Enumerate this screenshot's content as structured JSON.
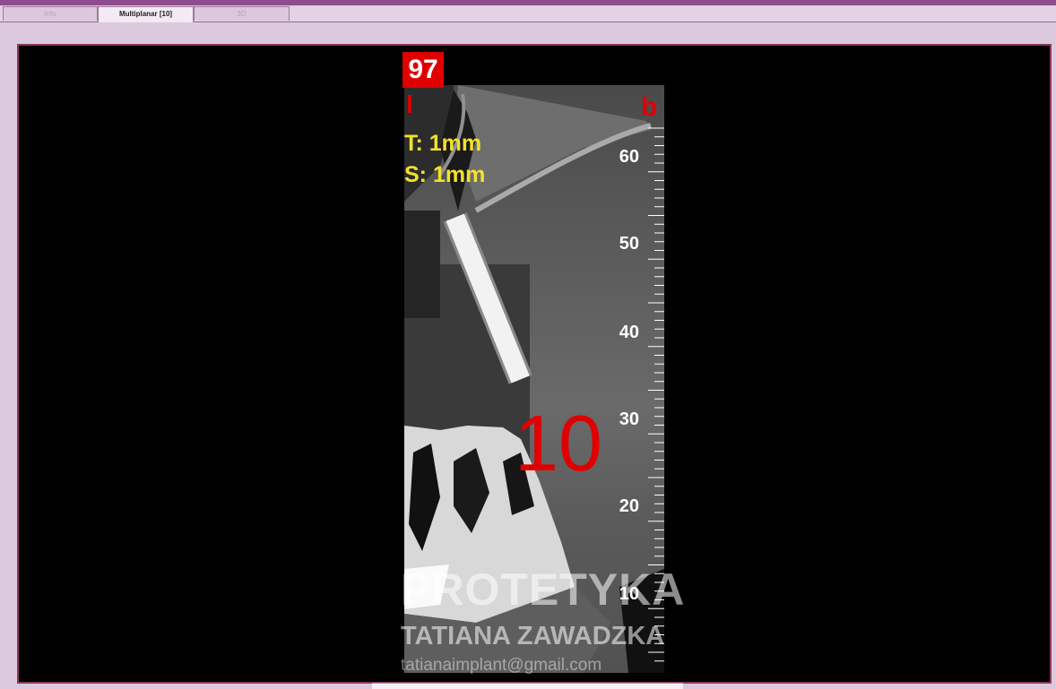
{
  "tabs": [
    {
      "label": "Info",
      "active": false
    },
    {
      "label": "Multiplanar [10]",
      "active": true
    },
    {
      "label": "3D",
      "active": false
    }
  ],
  "viewer": {
    "slice_number": "97",
    "orientation_left": "l",
    "orientation_right": "b",
    "thickness": "T: 1mm",
    "spacing": "S: 1mm",
    "implant_number": "10",
    "ruler_labels": [
      "60",
      "50",
      "40",
      "30",
      "20",
      "10"
    ],
    "watermark": {
      "line1": "PROTETYKA",
      "line2": "TATIANA ZAWADZKA",
      "line3": "tatianaimplant@gmail.com"
    }
  },
  "colors": {
    "accent_red": "#e00000",
    "info_yellow": "#f2e12b",
    "frame_border": "#8a3a5a",
    "window_bg": "#ddc9dd"
  }
}
